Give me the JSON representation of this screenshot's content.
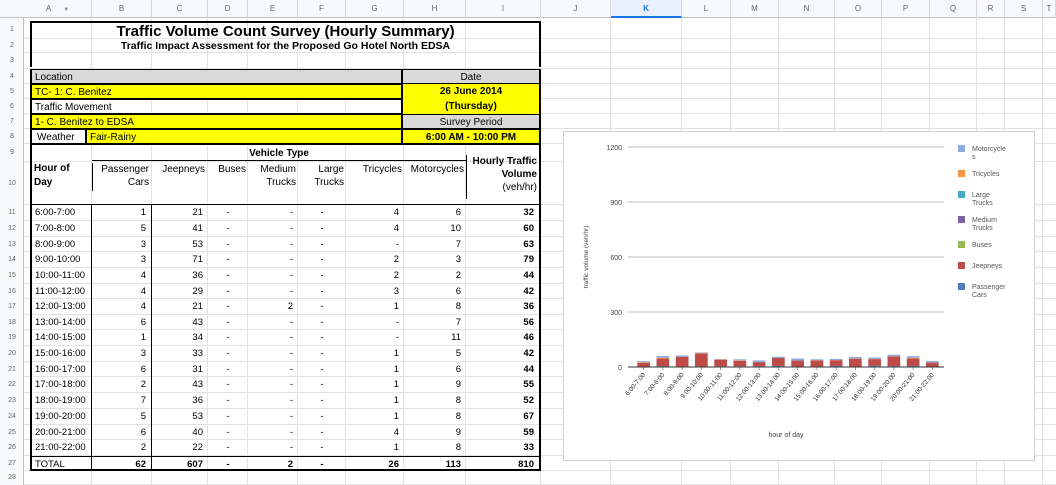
{
  "columns": [
    "A",
    "B",
    "C",
    "D",
    "E",
    "F",
    "G",
    "H",
    "I",
    "J",
    "K",
    "L",
    "M",
    "N",
    "O",
    "P",
    "Q",
    "R",
    "S",
    "T"
  ],
  "selected_column": "K",
  "rows": [
    "1",
    "2",
    "3",
    "4",
    "5",
    "6",
    "7",
    "8",
    "9",
    "10",
    "11",
    "12",
    "13",
    "14",
    "15",
    "16",
    "17",
    "18",
    "19",
    "20",
    "21",
    "22",
    "23",
    "24",
    "25",
    "26",
    "27",
    "28"
  ],
  "sheet": {
    "title": "Traffic Volume Count Survey (Hourly Summary)",
    "subtitle": "Traffic Impact Assessment for the Proposed Go Hotel North EDSA",
    "location_label": "Location",
    "location_value": "TC- 1: C. Benitez",
    "movement_label": "Traffic Movement",
    "movement_value": "1- C. Benitez to EDSA",
    "weather_label": "Weather",
    "weather_value": "Fair-Rainy",
    "date_label": "Date",
    "date_value": "26 June 2014",
    "day_value": "(Thursday)",
    "period_label": "Survey Period",
    "period_value": "6:00 AM - 10:00 PM",
    "vehicle_type": "Vehicle Type",
    "hour_header_1": "Hour of",
    "hour_header_2": "Day",
    "col_passenger_1": "Passenger",
    "col_passenger_2": "Cars",
    "col_jeepneys": "Jeepneys",
    "col_buses": "Buses",
    "col_medium_1": "Medium",
    "col_medium_2": "Trucks",
    "col_large_1": "Large",
    "col_large_2": "Trucks",
    "col_tricycles": "Tricycles",
    "col_motorcycles": "Motorcycles",
    "col_hourly_1": "Hourly Traffic",
    "col_hourly_2": "Volume",
    "col_hourly_3": "(veh/hr)",
    "data_rows": [
      {
        "hour": "6:00-7:00",
        "pc": "1",
        "jp": "21",
        "bus": "-",
        "mt": "-",
        "lt": "-",
        "tri": "4",
        "moto": "6",
        "total": "32"
      },
      {
        "hour": "7:00-8:00",
        "pc": "5",
        "jp": "41",
        "bus": "-",
        "mt": "-",
        "lt": "-",
        "tri": "4",
        "moto": "10",
        "total": "60"
      },
      {
        "hour": "8:00-9:00",
        "pc": "3",
        "jp": "53",
        "bus": "-",
        "mt": "-",
        "lt": "-",
        "tri": "-",
        "moto": "7",
        "total": "63"
      },
      {
        "hour": "9:00-10:00",
        "pc": "3",
        "jp": "71",
        "bus": "-",
        "mt": "-",
        "lt": "-",
        "tri": "2",
        "moto": "3",
        "total": "79"
      },
      {
        "hour": "10:00-11:00",
        "pc": "4",
        "jp": "36",
        "bus": "-",
        "mt": "-",
        "lt": "-",
        "tri": "2",
        "moto": "2",
        "total": "44"
      },
      {
        "hour": "11:00-12:00",
        "pc": "4",
        "jp": "29",
        "bus": "-",
        "mt": "-",
        "lt": "-",
        "tri": "3",
        "moto": "6",
        "total": "42"
      },
      {
        "hour": "12:00-13:00",
        "pc": "4",
        "jp": "21",
        "bus": "-",
        "mt": "2",
        "lt": "-",
        "tri": "1",
        "moto": "8",
        "total": "36"
      },
      {
        "hour": "13:00-14:00",
        "pc": "6",
        "jp": "43",
        "bus": "-",
        "mt": "-",
        "lt": "-",
        "tri": "-",
        "moto": "7",
        "total": "56"
      },
      {
        "hour": "14:00-15:00",
        "pc": "1",
        "jp": "34",
        "bus": "-",
        "mt": "-",
        "lt": "-",
        "tri": "-",
        "moto": "11",
        "total": "46"
      },
      {
        "hour": "15:00-16:00",
        "pc": "3",
        "jp": "33",
        "bus": "-",
        "mt": "-",
        "lt": "-",
        "tri": "1",
        "moto": "5",
        "total": "42"
      },
      {
        "hour": "16:00-17:00",
        "pc": "6",
        "jp": "31",
        "bus": "-",
        "mt": "-",
        "lt": "-",
        "tri": "1",
        "moto": "6",
        "total": "44"
      },
      {
        "hour": "17:00-18:00",
        "pc": "2",
        "jp": "43",
        "bus": "-",
        "mt": "-",
        "lt": "-",
        "tri": "1",
        "moto": "9",
        "total": "55"
      },
      {
        "hour": "18:00-19:00",
        "pc": "7",
        "jp": "36",
        "bus": "-",
        "mt": "-",
        "lt": "-",
        "tri": "1",
        "moto": "8",
        "total": "52"
      },
      {
        "hour": "19:00-20:00",
        "pc": "5",
        "jp": "53",
        "bus": "-",
        "mt": "-",
        "lt": "-",
        "tri": "1",
        "moto": "8",
        "total": "67"
      },
      {
        "hour": "20:00-21:00",
        "pc": "6",
        "jp": "40",
        "bus": "-",
        "mt": "-",
        "lt": "-",
        "tri": "4",
        "moto": "9",
        "total": "59"
      },
      {
        "hour": "21:00-22:00",
        "pc": "2",
        "jp": "22",
        "bus": "-",
        "mt": "-",
        "lt": "-",
        "tri": "1",
        "moto": "8",
        "total": "33"
      }
    ],
    "total_row": {
      "hour": "TOTAL",
      "pc": "62",
      "jp": "607",
      "bus": "-",
      "mt": "2",
      "lt": "-",
      "tri": "26",
      "moto": "113",
      "total": "810"
    }
  },
  "chart_data": {
    "type": "bar",
    "stacked": true,
    "xlabel": "hour of day",
    "ylabel": "traffic volume (veh/hr)",
    "ylim": [
      0,
      1200
    ],
    "yticks": [
      "0",
      "300",
      "600",
      "900",
      "1200"
    ],
    "ytick_values": [
      0,
      300,
      600,
      900,
      1200
    ],
    "legend_position": "right",
    "categories": [
      "6:00-7:00",
      "7:00-8:00",
      "8:00-9:00",
      "9:00-10:00",
      "10:00-11:00",
      "11:00-12:00",
      "12:00-13:00",
      "13:00-14:00",
      "14:00-15:00",
      "15:00-16:00",
      "16:00-17:00",
      "17:00-18:00",
      "18:00-19:00",
      "19:00-20:00",
      "20:00-21:00",
      "21:00-22:00"
    ],
    "series": [
      {
        "name": "Passenger Cars",
        "color": "#4a7ebb",
        "values": [
          1,
          5,
          3,
          3,
          4,
          4,
          4,
          6,
          1,
          3,
          6,
          2,
          7,
          5,
          6,
          2
        ]
      },
      {
        "name": "Jeepneys",
        "color": "#be4b48",
        "values": [
          21,
          41,
          53,
          71,
          36,
          29,
          21,
          43,
          34,
          33,
          31,
          43,
          36,
          53,
          40,
          22
        ]
      },
      {
        "name": "Buses",
        "color": "#98b954",
        "values": [
          0,
          0,
          0,
          0,
          0,
          0,
          0,
          0,
          0,
          0,
          0,
          0,
          0,
          0,
          0,
          0
        ]
      },
      {
        "name": "Medium Trucks",
        "color": "#7d60a0",
        "values": [
          0,
          0,
          0,
          0,
          0,
          0,
          2,
          0,
          0,
          0,
          0,
          0,
          0,
          0,
          0,
          0
        ]
      },
      {
        "name": "Large Trucks",
        "color": "#46aac5",
        "values": [
          0,
          0,
          0,
          0,
          0,
          0,
          0,
          0,
          0,
          0,
          0,
          0,
          0,
          0,
          0,
          0
        ]
      },
      {
        "name": "Tricycles",
        "color": "#f79646",
        "values": [
          4,
          4,
          0,
          2,
          2,
          3,
          1,
          0,
          0,
          1,
          1,
          1,
          1,
          1,
          4,
          1
        ]
      },
      {
        "name": "Motorcycles",
        "color": "#8ea9db",
        "values": [
          6,
          10,
          7,
          3,
          2,
          6,
          8,
          7,
          11,
          5,
          6,
          9,
          8,
          8,
          9,
          8
        ]
      }
    ],
    "legend": [
      {
        "lines": [
          "Motorcycle",
          "s"
        ],
        "color": "#8ea9db"
      },
      {
        "lines": [
          "Tricycles"
        ],
        "color": "#f79646"
      },
      {
        "lines": [
          "Large",
          "Trucks"
        ],
        "color": "#46aac5"
      },
      {
        "lines": [
          "Medium",
          "Trucks"
        ],
        "color": "#7d60a0"
      },
      {
        "lines": [
          "Buses"
        ],
        "color": "#98b954"
      },
      {
        "lines": [
          "Jeepneys"
        ],
        "color": "#be4b48"
      },
      {
        "lines": [
          "Passenger",
          "Cars"
        ],
        "color": "#4a7ebb"
      }
    ]
  }
}
